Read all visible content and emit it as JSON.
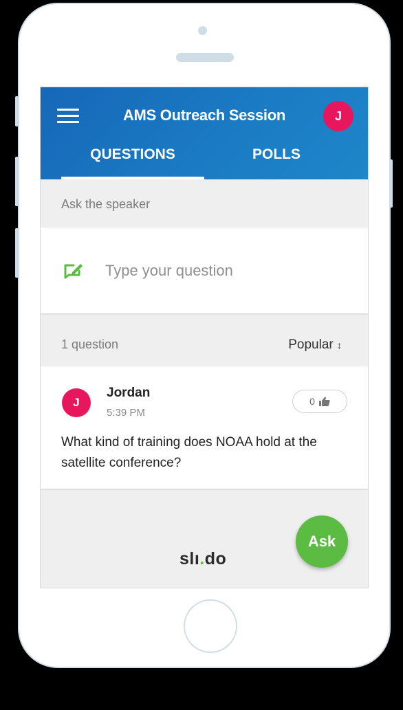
{
  "header": {
    "title": "AMS Outreach Session",
    "avatar_initial": "J",
    "tabs": [
      {
        "label": "QUESTIONS",
        "active": true
      },
      {
        "label": "POLLS",
        "active": false
      }
    ]
  },
  "ask": {
    "section_label": "Ask the speaker",
    "placeholder": "Type your question"
  },
  "questions": {
    "count_label": "1 question",
    "sort_label": "Popular",
    "sort_icon": "↕",
    "items": [
      {
        "author": "Jordan",
        "author_initial": "J",
        "time": "5:39 PM",
        "likes": "0",
        "text": "What kind of training does NOAA hold at the satellite conference?"
      }
    ]
  },
  "footer": {
    "logo_main": "slı",
    "logo_dot": ".",
    "logo_end": "do",
    "ask_button": "Ask"
  },
  "colors": {
    "header_blue": "#1b7cc4",
    "avatar_pink": "#e8175d",
    "brand_green": "#5cbb42"
  }
}
